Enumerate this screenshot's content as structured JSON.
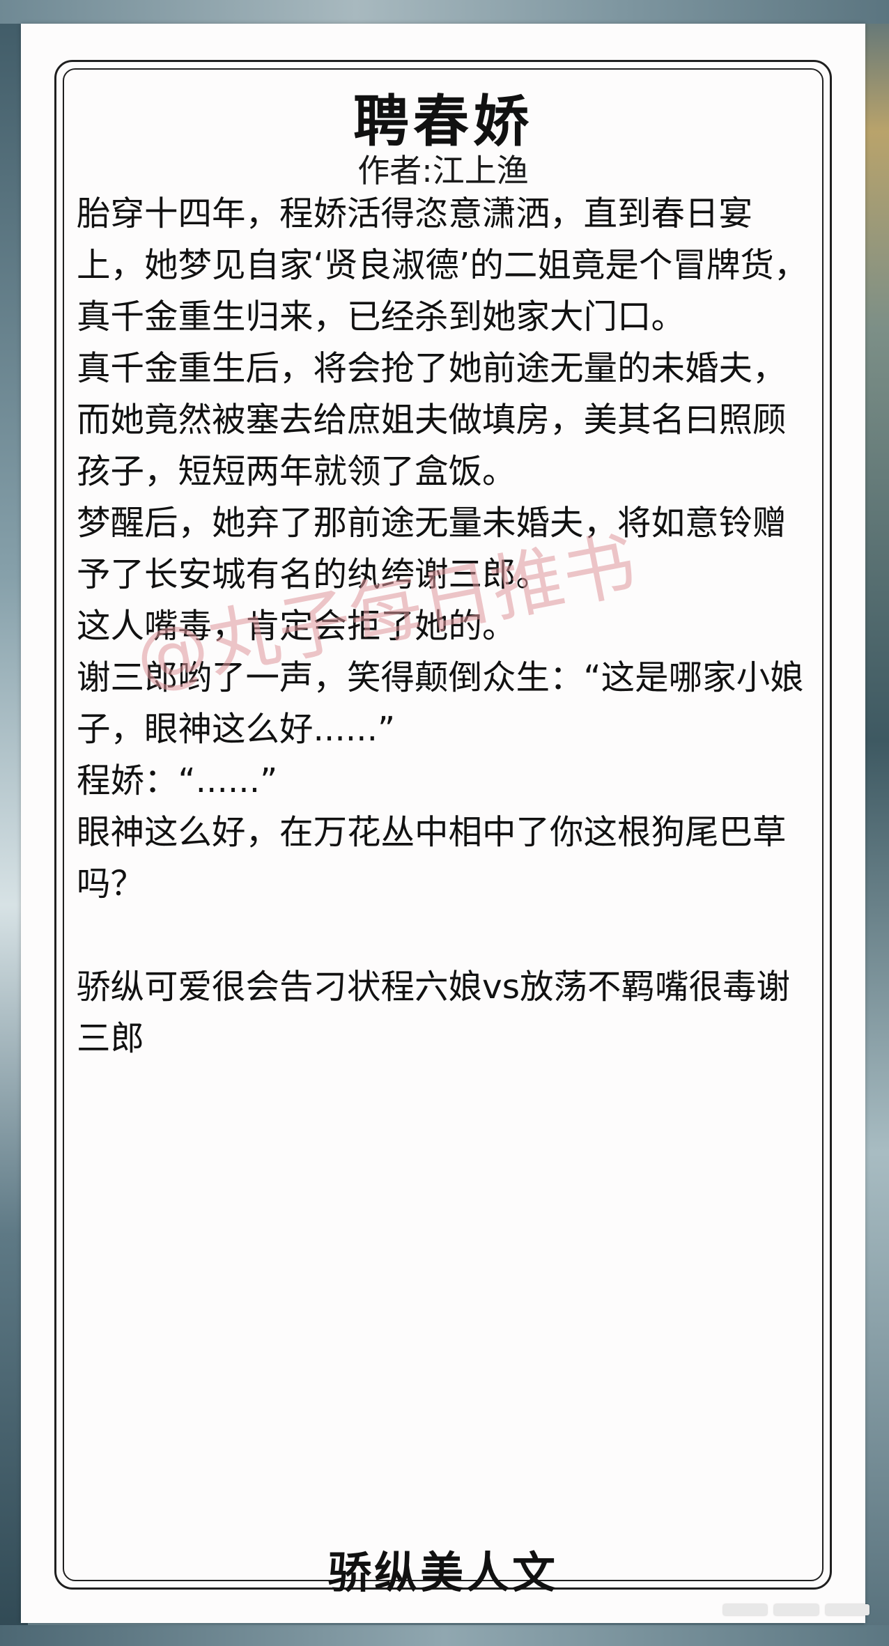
{
  "post": {
    "title": "聘春娇",
    "author": "作者:江上渔",
    "paragraphs": [
      "胎穿十四年，程娇活得恣意潇洒，直到春日宴上，她梦见自家‘贤良淑德’的二姐竟是个冒牌货，真千金重生归来，已经杀到她家大门口。",
      "真千金重生后，将会抢了她前途无量的未婚夫，而她竟然被塞去给庶姐夫做填房，美其名曰照顾孩子，短短两年就领了盒饭。",
      "梦醒后，她弃了那前途无量未婚夫，将如意铃赠予了长安城有名的纨绔谢三郎。",
      "这人嘴毒，肯定会拒了她的。",
      "谢三郎哟了一声，笑得颠倒众生：“这是哪家小娘子，眼神这么好......”",
      "程娇：“......”",
      "眼神这么好，在万花丛中相中了你这根狗尾巴草吗？"
    ],
    "tagline": "骄纵可爱很会告刁状程六娘vs放荡不羁嘴很毒谢三郎",
    "watermark": "@丸子每日推书",
    "footer": "骄纵美人文"
  },
  "icons": {
    "more": "more-icon"
  }
}
